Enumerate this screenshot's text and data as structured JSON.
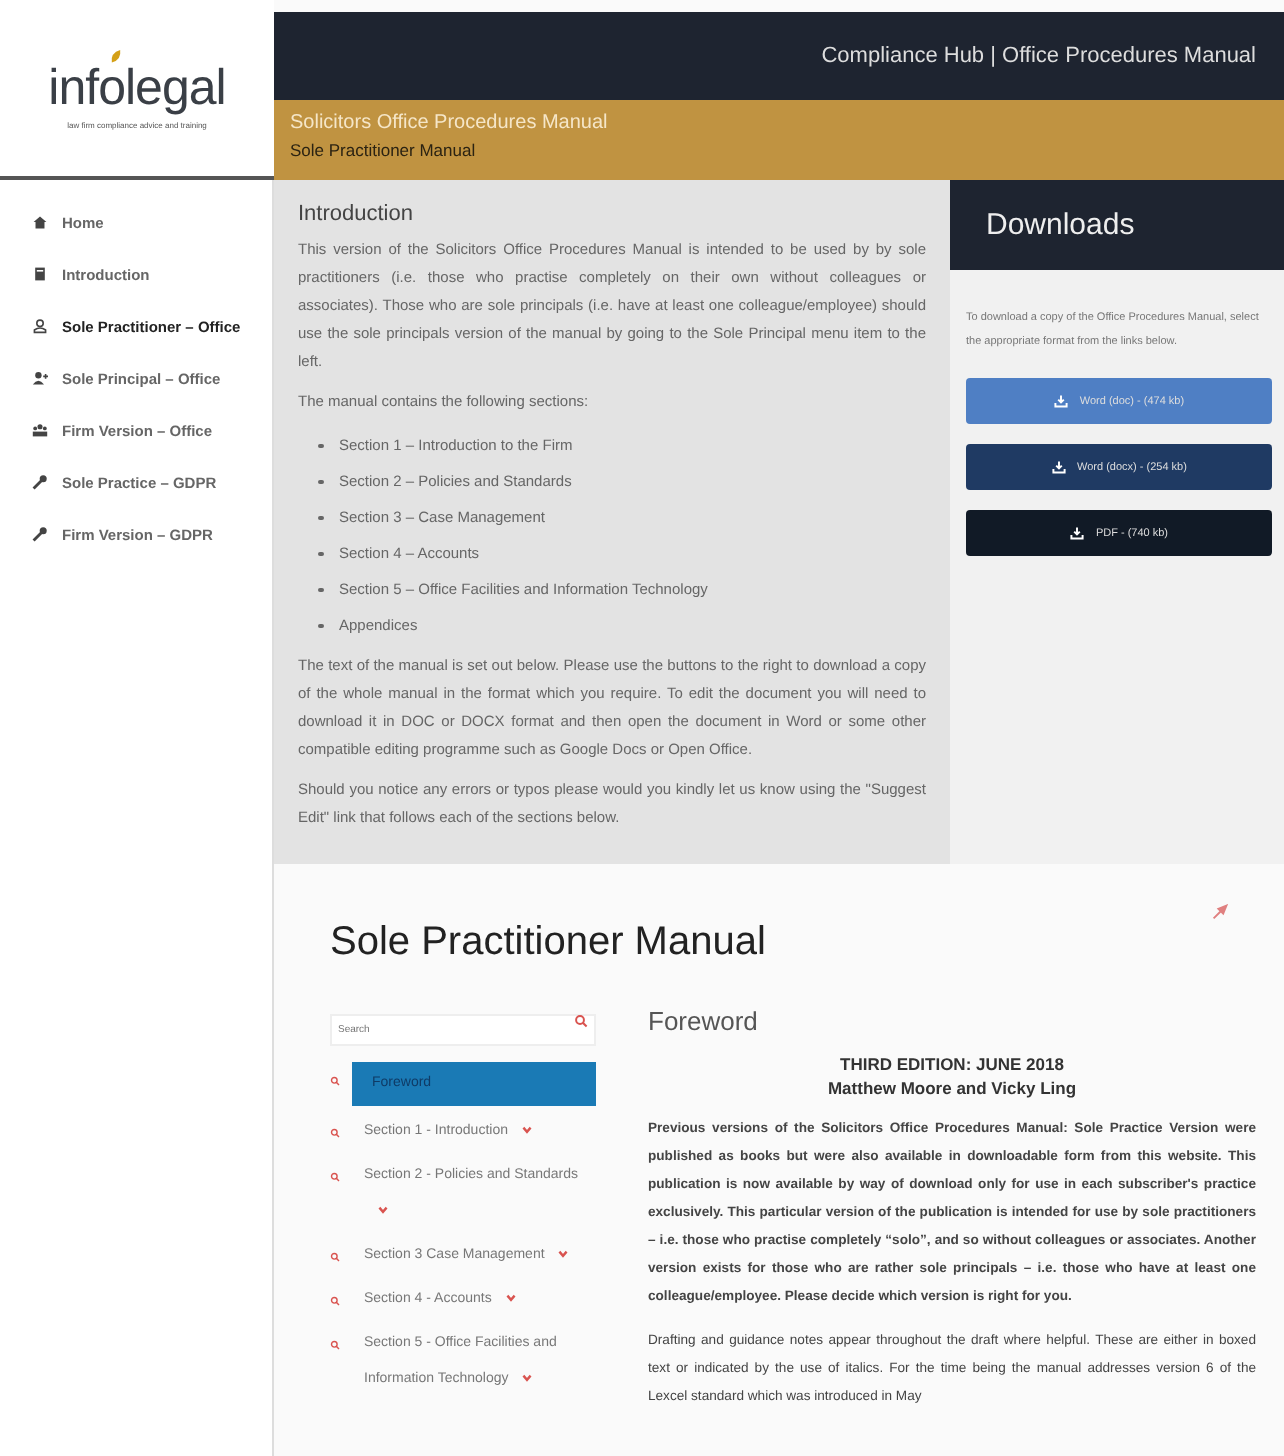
{
  "logo": {
    "name_start": "inf",
    "name_mark": "o",
    "name_end": "legal",
    "tagline": "law firm compliance advice and training"
  },
  "header": {
    "title": "Compliance Hub | Office Procedures Manual"
  },
  "banner": {
    "title": "Solicitors Office Procedures Manual",
    "subtitle": "Sole Practitioner Manual"
  },
  "sidebar": {
    "items": [
      {
        "label": "Home",
        "kind": "home",
        "selected": false
      },
      {
        "label": "Introduction",
        "kind": "book",
        "selected": false
      },
      {
        "label": "Sole Practitioner – Office",
        "kind": "user",
        "selected": true
      },
      {
        "label": "Sole Principal – Office",
        "kind": "user-plus",
        "selected": false
      },
      {
        "label": "Firm Version – Office",
        "kind": "users",
        "selected": false
      },
      {
        "label": "Sole Practice – GDPR",
        "kind": "wrench",
        "selected": false
      },
      {
        "label": "Firm Version – GDPR",
        "kind": "wrench",
        "selected": false
      }
    ]
  },
  "introduction": {
    "title": "Introduction",
    "paragraph_1": "This version of the Solicitors Office Procedures Manual is intended to be used by by sole practitioners (i.e. those who practise completely on their own without colleagues or associates). Those who are sole principals (i.e. have at least one colleague/employee) should use the sole principals version of the manual by going to the Sole Principal menu item to the left.",
    "paragraph_2": "The manual contains the following sections:",
    "sections": [
      "Section 1 – Introduction to the Firm",
      "Section 2 – Policies and Standards",
      "Section 3 – Case Management",
      "Section 4 – Accounts",
      "Section 5 – Office Facilities and Information Technology",
      "Appendices"
    ],
    "paragraph_3": "The text of the manual is set out below.  Please use the buttons to the right to download a copy of the whole manual in the format which you require.  To edit the document you will need to download it in DOC or DOCX format and then open the document in Word or some other compatible editing programme such as Google Docs or Open Office.",
    "paragraph_4": "Should you notice any errors or typos please would you kindly let us know using the \"Suggest Edit\" link that follows each of the sections below."
  },
  "downloads": {
    "title": "Downloads",
    "text": "To download a copy of the Office Procedures Manual, select the appropriate format from the links below.",
    "buttons": [
      {
        "label": "Word (doc) - (474 kb)",
        "color": "#4f7fc4"
      },
      {
        "label": "Word (docx) - (254 kb)",
        "color": "#1f3a63"
      },
      {
        "label": "PDF - (740 kb)",
        "color": "#111a26"
      }
    ]
  },
  "manual": {
    "title": "Sole Practitioner Manual",
    "search": {
      "placeholder": "Search"
    },
    "toc": [
      {
        "label": "Foreword",
        "selected": true,
        "expandable": false
      },
      {
        "label": "Section 1 - Introduction",
        "selected": false,
        "expandable": true
      },
      {
        "label": "Section 2 - Policies and Standards",
        "selected": false,
        "expandable": true
      },
      {
        "label": "Section 3 Case Management",
        "selected": false,
        "expandable": true
      },
      {
        "label": "Section 4 - Accounts",
        "selected": false,
        "expandable": true
      },
      {
        "label": "Section 5 - Office Facilities and Information Technology",
        "selected": false,
        "expandable": true
      }
    ],
    "foreword": {
      "title": "Foreword",
      "edition": "THIRD EDITION: JUNE 2018",
      "authors": "Matthew Moore and Vicky Ling",
      "paragraph_1": "Previous versions of the Solicitors Office Procedures Manual: Sole Practice Version were published as books but were also available in downloadable form from this website. This publication is now available by way of download only for use in each subscriber's practice exclusively. This particular version of the publication is intended for use by sole practitioners – i.e. those who practise completely “solo”, and so without colleagues or associates. Another version exists for those who are rather sole principals – i.e. those who have at least one colleague/employee. Please decide which version is right for you.",
      "paragraph_2": "Drafting and guidance notes appear throughout the draft where helpful. These are either in boxed text or indicated by the use of italics. For the time being the manual addresses version 6 of the Lexcel standard which was introduced in May"
    }
  }
}
